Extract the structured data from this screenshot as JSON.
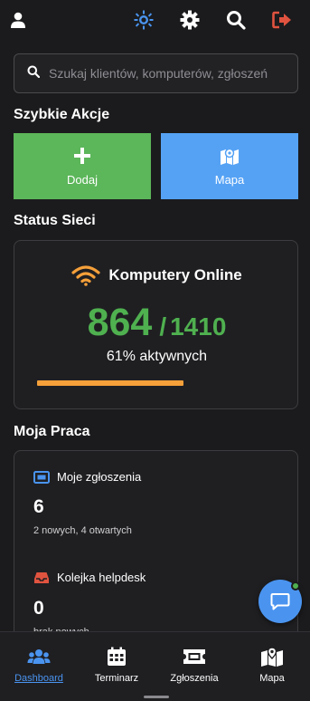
{
  "topbar": {
    "icons": [
      "user-icon",
      "sun-icon",
      "gear-icon",
      "search-icon",
      "logout-icon"
    ]
  },
  "search": {
    "placeholder": "Szukaj klientów, komputerów, zgłoszeń"
  },
  "quick_actions": {
    "title": "Szybkie Akcje",
    "add_label": "Dodaj",
    "map_label": "Mapa",
    "add_color": "#5cb65a",
    "map_color": "#55a2f5"
  },
  "network": {
    "title": "Status Sieci",
    "card_title": "Komputery Online",
    "online": "864",
    "separator": "/",
    "total": "1410",
    "active_text": "61% aktywnych",
    "progress_fraction": 0.61
  },
  "work": {
    "title": "Moja Praca",
    "tickets_label": "Moje zgłoszenia",
    "tickets_count": "6",
    "tickets_sub": "2 nowych, 4 otwartych",
    "helpdesk_label": "Kolejka helpdesk",
    "helpdesk_count": "0",
    "helpdesk_sub": "brak nowych"
  },
  "tabs": [
    {
      "label": "Dashboard",
      "icon": "users-icon",
      "active": true
    },
    {
      "label": "Terminarz",
      "icon": "calendar-icon",
      "active": false
    },
    {
      "label": "Zgłoszenia",
      "icon": "ticket-icon",
      "active": false
    },
    {
      "label": "Mapa",
      "icon": "map-icon",
      "active": false
    }
  ],
  "colors": {
    "accent": "#4a94f0",
    "online": "#4fb04f",
    "warning": "#f5a03a",
    "logout": "#e0533f"
  }
}
